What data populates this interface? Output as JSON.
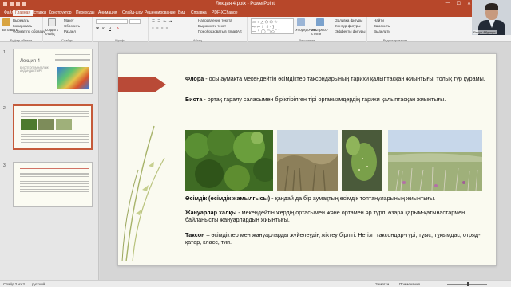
{
  "app": {
    "document_title": "Лекция 4.pptx - PowerPoint",
    "window_buttons": [
      "—",
      "☐",
      "✕"
    ]
  },
  "tabs": [
    "Файл",
    "Главная",
    "Вставка",
    "Конструктор",
    "Переходы",
    "Анимация",
    "Слайд-шоу",
    "Рецензирование",
    "Вид",
    "Справка",
    "PDF-XChange"
  ],
  "ribbon": {
    "clipboard": {
      "group": "Буфер обмена",
      "paste": "Вставить",
      "cut": "Вырезать",
      "copy": "Копировать",
      "format": "Формат по образцу"
    },
    "slides": {
      "group": "Слайды",
      "new_slide": "Создать слайд",
      "layout": "Макет",
      "reset": "Сбросить",
      "section": "Раздел"
    },
    "font": {
      "group": "Шрифт"
    },
    "paragraph": {
      "group": "Абзац",
      "text_dir": "Направление текста",
      "align": "Выровнять текст",
      "smartart": "Преобразовать в SmartArt"
    },
    "drawing": {
      "group": "Рисование",
      "arrange": "Упорядочить",
      "styles": "Экспресс-стили",
      "fill": "Заливка фигуры",
      "outline": "Контур фигуры",
      "effects": "Эффекты фигуры"
    },
    "editing": {
      "group": "Редактирование",
      "find": "Найти",
      "replace": "Заменить",
      "select": "Выделить"
    }
  },
  "thumbnails": [
    {
      "number": "1",
      "title": "Лекция 4",
      "subtitle": "БИОГЕОГРАФИЯЛЫҚ АУДАНДАСТЫРУ"
    },
    {
      "number": "2",
      "title": "",
      "subtitle": ""
    },
    {
      "number": "3",
      "title": "",
      "subtitle": ""
    }
  ],
  "slide": {
    "p1_term": "Флора",
    "p1_text": " - осы аумақта мекендейтін өсімдіктер таксондарының тарихи қалыптасқан жиынтығы, толық түр құрамы.",
    "p2_term": "Биота",
    "p2_text": " - ортақ таралу саласымен біріктірілген тірі организмдердің тарихи қалыптасқан жиынтығы.",
    "p3_term": "Өсімдік (өсімдік жамылғысы)",
    "p3_text": " - қандай да бір аумақтың өсімдік топтануларының жиынтығы.",
    "p4_term": "Жануарлар халқы",
    "p4_text": " - мекендейтін жердің ортасымен және ортамен әр түрлі өзара қарым-қатынастармен байланысты жануарлардың жиынтығы.",
    "p5_term": "Таксон",
    "p5_text": " – өсімдіктер мен жануарларды жүйелеудің жіктеу бірлігі. Негізгі таксондар-түрі, тұыс, тұқымдас, отряд-қатар, класс, тип."
  },
  "status": {
    "slide_count": "Слайд 2 из 3",
    "language": "русский",
    "notes": "Заметки",
    "comments": "Примечания"
  },
  "webcam": {
    "caption": "Расул Абдикул"
  },
  "colors": {
    "accent": "#b7472a",
    "arrow": "#b94a37"
  }
}
